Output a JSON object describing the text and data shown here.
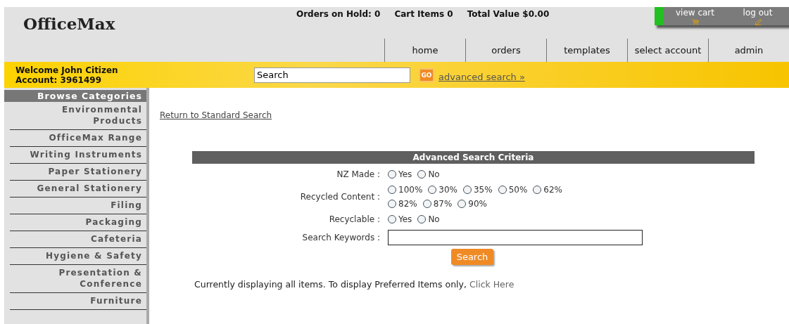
{
  "logo": "OfficeMax",
  "stats": [
    "Orders on Hold: 0",
    "Cart Items 0",
    "Total Value $0.00"
  ],
  "account_tabs": [
    {
      "label": "view cart",
      "kind": "cart"
    },
    {
      "label": "log out",
      "kind": "logout"
    }
  ],
  "nav": [
    "home",
    "orders",
    "templates",
    "select account",
    "admin"
  ],
  "welcome": [
    "Welcome John Citizen",
    "Account: 3961499"
  ],
  "search": {
    "value": "Search",
    "go": "GO",
    "advanced_link": "advanced search »"
  },
  "sidebar": {
    "title": "Browse Categories",
    "items": [
      "Environmental Products",
      "OfficeMax Range",
      "Writing Instruments",
      "Paper Stationery",
      "General Stationery",
      "Filing",
      "Packaging",
      "Cafeteria",
      "Hygiene & Safety",
      "Presentation & Conference",
      "Furniture"
    ]
  },
  "return_link": "Return to Standard Search",
  "criteria": {
    "title": "Advanced Search Criteria",
    "fields": [
      {
        "label": "NZ Made :",
        "kind": "radio",
        "options": [
          {
            "label": "Yes",
            "selected": false
          },
          {
            "label": "No",
            "selected": false
          }
        ]
      },
      {
        "label": "Recycled Content :",
        "kind": "radio",
        "options": [
          {
            "label": "100%",
            "selected": false
          },
          {
            "label": "30%",
            "selected": false
          },
          {
            "label": "35%",
            "selected": false
          },
          {
            "label": "50%",
            "selected": false
          },
          {
            "label": "62%",
            "selected": false
          },
          {
            "label": "82%",
            "selected": false
          },
          {
            "label": "87%",
            "selected": false
          },
          {
            "label": "90%",
            "selected": false
          }
        ]
      },
      {
        "label": "Recyclable :",
        "kind": "radio",
        "options": [
          {
            "label": "Yes",
            "selected": false
          },
          {
            "label": "No",
            "selected": false
          }
        ]
      },
      {
        "label": "Search Keywords :",
        "kind": "text"
      }
    ],
    "button": "Search"
  },
  "footer_note": {
    "text": "Currently displaying all items. To display Preferred Items only,",
    "link": "Click Here"
  }
}
